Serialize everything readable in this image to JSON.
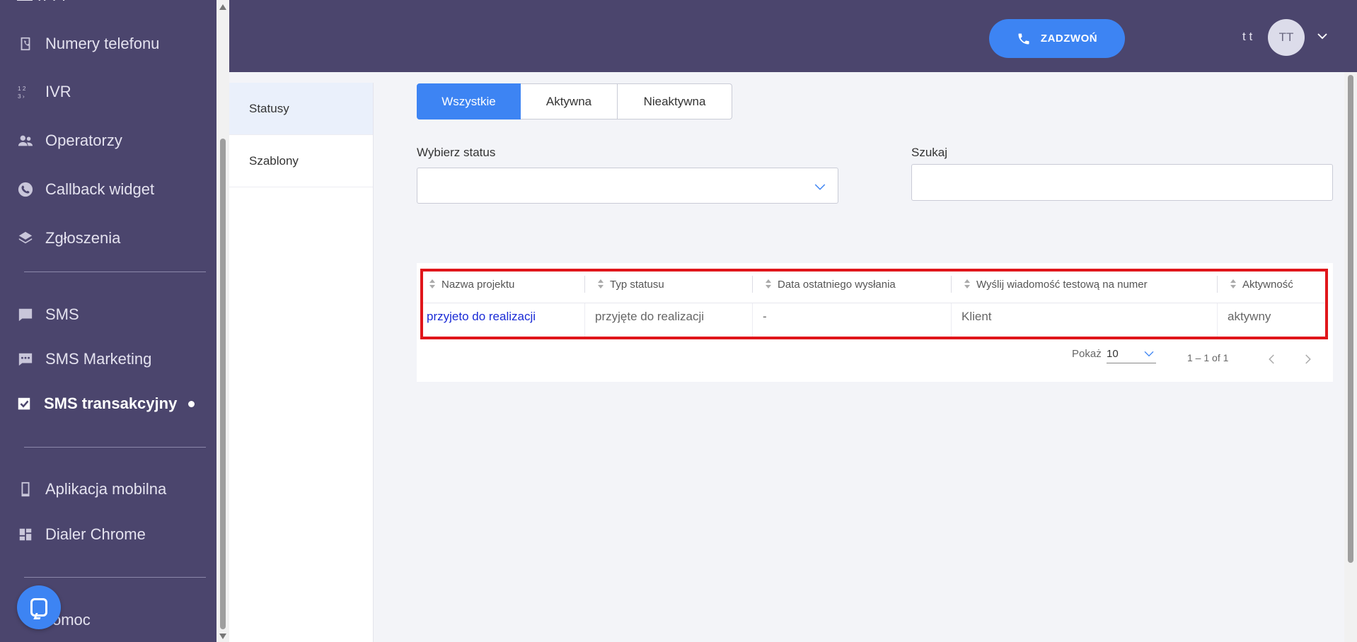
{
  "sidebar": {
    "partial_top": "— ·· · ·",
    "items": [
      {
        "label": "Numery telefonu",
        "icon": "phone-book-icon"
      },
      {
        "label": "IVR",
        "icon": "ivr-numbers-icon"
      },
      {
        "label": "Operatorzy",
        "icon": "users-icon"
      },
      {
        "label": "Callback widget",
        "icon": "phone-circle-icon"
      },
      {
        "label": "Zgłoszenia",
        "icon": "layers-icon"
      },
      {
        "label": "SMS",
        "icon": "chat-icon"
      },
      {
        "label": "SMS Marketing",
        "icon": "chat-dots-icon"
      },
      {
        "label": "SMS transakcyjny",
        "icon": "check-box-icon",
        "active": true
      },
      {
        "label": "Aplikacja mobilna",
        "icon": "mobile-icon"
      },
      {
        "label": "Dialer Chrome",
        "icon": "dashboard-icon"
      }
    ],
    "help_label": "omoc"
  },
  "header": {
    "call_button": "ZADZWOŃ",
    "user_short": "t t",
    "avatar_initials": "TT"
  },
  "subnav": {
    "items": [
      "Statusy",
      "Szablony"
    ]
  },
  "tabs": [
    "Wszystkie",
    "Aktywna",
    "Nieaktywna"
  ],
  "filters": {
    "status_label": "Wybierz status",
    "status_value": "",
    "search_label": "Szukaj",
    "search_value": ""
  },
  "table": {
    "columns": [
      "Nazwa projektu",
      "Typ statusu",
      "Data ostatniego wysłania",
      "Wyślij wiadomość testową na numer",
      "Aktywność"
    ],
    "rows": [
      [
        "przyjeto do realizacji",
        "przyjęte do realizacji",
        "-",
        "Klient",
        "aktywny"
      ]
    ]
  },
  "pager": {
    "label": "Pokaż",
    "page_size": "10",
    "range": "1 – 1 of 1"
  },
  "colors": {
    "sidebar_bg": "#4b456d",
    "accent": "#3d84f3",
    "highlight_border": "#e0161b",
    "link": "#1a2bd6"
  }
}
